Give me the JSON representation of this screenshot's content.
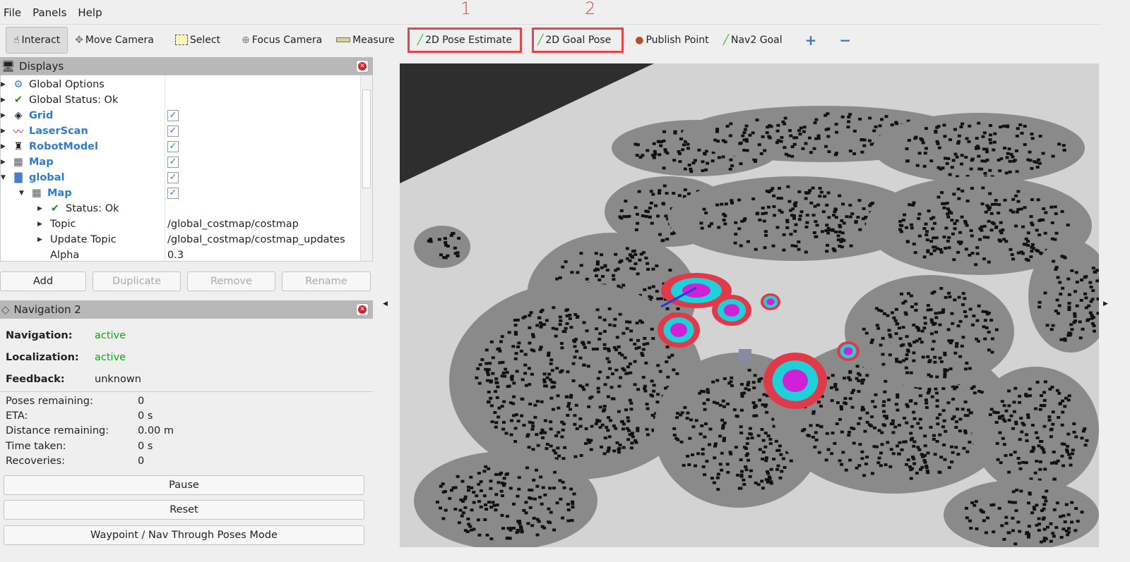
{
  "menu": [
    "File",
    "Panels",
    "Help"
  ],
  "toolbar": [
    {
      "label": "Interact",
      "icon": "hand-icon"
    },
    {
      "label": "Move Camera",
      "icon": "move-camera-icon"
    },
    {
      "label": "Select",
      "icon": "select-icon"
    },
    {
      "label": "Focus Camera",
      "icon": "focus-camera-icon"
    },
    {
      "label": "Measure",
      "icon": "ruler-icon"
    },
    {
      "label": "2D Pose Estimate",
      "icon": "green-arrow-icon"
    },
    {
      "label": "2D Goal Pose",
      "icon": "green-arrow-icon"
    },
    {
      "label": "Publish Point",
      "icon": "map-pin-icon"
    },
    {
      "label": "Nav2 Goal",
      "icon": "green-arrow-icon"
    }
  ],
  "annotations": [
    "1",
    "2"
  ],
  "displays": {
    "title": "Displays",
    "rows": [
      {
        "label": "Global Options"
      },
      {
        "label": "Global Status: Ok"
      },
      {
        "label": "Grid"
      },
      {
        "label": "LaserScan"
      },
      {
        "label": "RobotModel"
      },
      {
        "label": "Map"
      },
      {
        "label": "global"
      },
      {
        "label": "Map"
      },
      {
        "label": "Status: Ok"
      },
      {
        "label": "Topic",
        "value": "/global_costmap/costmap"
      },
      {
        "label": "Update Topic",
        "value": "/global_costmap/costmap_updates"
      },
      {
        "label": "Alpha",
        "value": "0.3"
      }
    ],
    "buttons": [
      "Add",
      "Duplicate",
      "Remove",
      "Rename"
    ]
  },
  "nav": {
    "title": "Navigation 2",
    "navigation_label": "Navigation:",
    "navigation": "active",
    "localization_label": "Localization:",
    "localization": "active",
    "feedback_label": "Feedback:",
    "feedback": "unknown",
    "stats": [
      {
        "label": "Poses remaining:",
        "value": "0"
      },
      {
        "label": "ETA:",
        "value": "0 s"
      },
      {
        "label": "Distance remaining:",
        "value": "0.00 m"
      },
      {
        "label": "Time taken:",
        "value": "0 s"
      },
      {
        "label": "Recoveries:",
        "value": "0"
      }
    ],
    "buttons": [
      "Pause",
      "Reset",
      "Waypoint / Nav Through Poses Mode"
    ]
  }
}
